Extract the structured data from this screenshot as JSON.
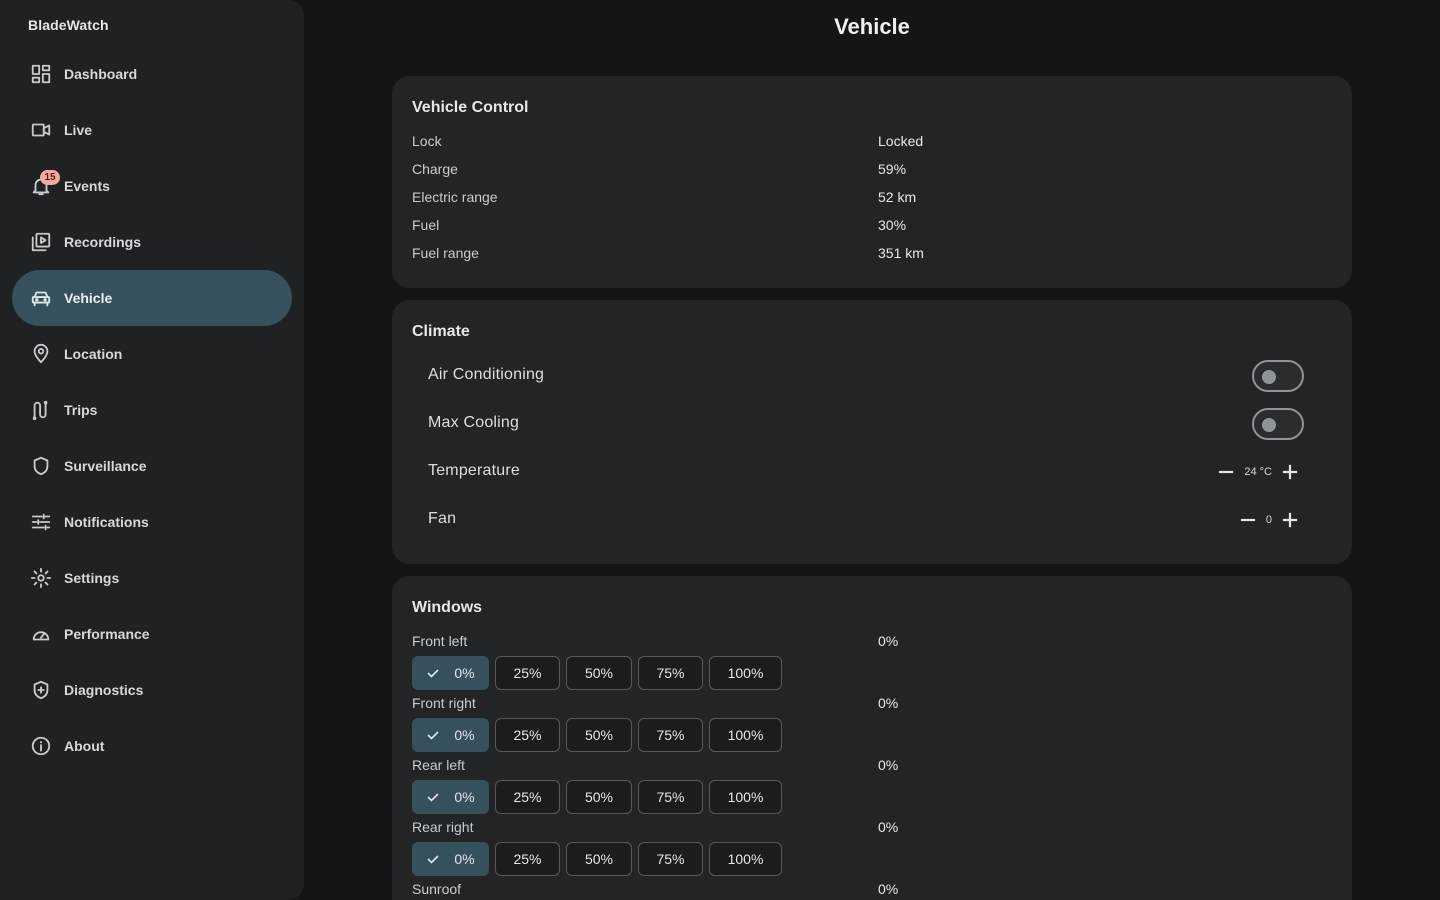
{
  "app": {
    "title": "BladeWatch"
  },
  "page": {
    "title": "Vehicle"
  },
  "sidebar": {
    "items": [
      {
        "label": "Dashboard",
        "icon": "dashboard-icon"
      },
      {
        "label": "Live",
        "icon": "videocam-icon"
      },
      {
        "label": "Events",
        "icon": "bell-icon",
        "badge": "15"
      },
      {
        "label": "Recordings",
        "icon": "video-library-icon"
      },
      {
        "label": "Vehicle",
        "icon": "car-icon",
        "active": true
      },
      {
        "label": "Location",
        "icon": "location-pin-icon"
      },
      {
        "label": "Trips",
        "icon": "route-icon"
      },
      {
        "label": "Surveillance",
        "icon": "shield-icon"
      },
      {
        "label": "Notifications",
        "icon": "tune-icon"
      },
      {
        "label": "Settings",
        "icon": "gear-icon"
      },
      {
        "label": "Performance",
        "icon": "speedometer-icon"
      },
      {
        "label": "Diagnostics",
        "icon": "health-shield-icon"
      },
      {
        "label": "About",
        "icon": "info-icon"
      }
    ]
  },
  "vehicle_control": {
    "title": "Vehicle Control",
    "rows": [
      {
        "label": "Lock",
        "value": "Locked"
      },
      {
        "label": "Charge",
        "value": "59%"
      },
      {
        "label": "Electric range",
        "value": "52 km"
      },
      {
        "label": "Fuel",
        "value": "30%"
      },
      {
        "label": "Fuel range",
        "value": "351 km"
      }
    ]
  },
  "climate": {
    "title": "Climate",
    "air_conditioning": {
      "label": "Air Conditioning",
      "on": false
    },
    "max_cooling": {
      "label": "Max Cooling",
      "on": false
    },
    "temperature": {
      "label": "Temperature",
      "value": "24 °C"
    },
    "fan": {
      "label": "Fan",
      "value": "0"
    }
  },
  "windows": {
    "title": "Windows",
    "options": [
      "0%",
      "25%",
      "50%",
      "75%",
      "100%"
    ],
    "items": [
      {
        "label": "Front left",
        "value": "0%",
        "selected": "0%"
      },
      {
        "label": "Front right",
        "value": "0%",
        "selected": "0%"
      },
      {
        "label": "Rear left",
        "value": "0%",
        "selected": "0%"
      },
      {
        "label": "Rear right",
        "value": "0%",
        "selected": "0%"
      },
      {
        "label": "Sunroof",
        "value": "0%"
      }
    ]
  }
}
